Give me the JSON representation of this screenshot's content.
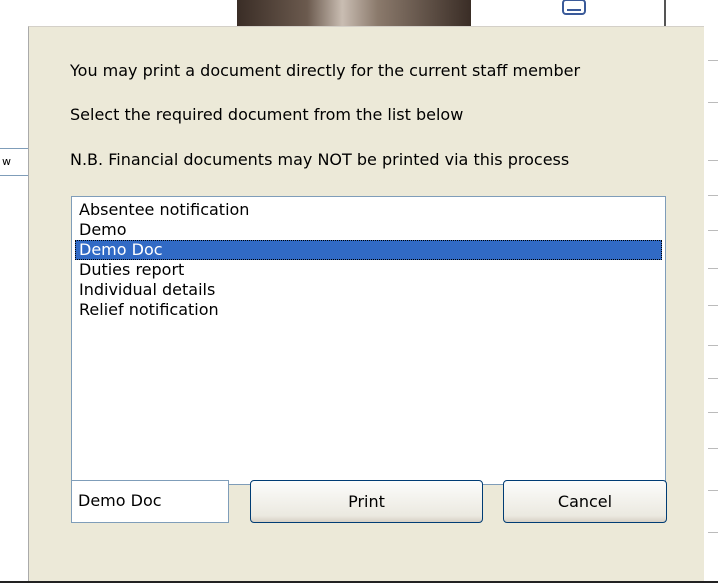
{
  "background": {
    "side_tab_label": "w"
  },
  "dialog": {
    "messages": [
      "You may print a document directly for the current staff member",
      "Select the required document from the list below",
      "N.B. Financial documents may NOT be printed via this process"
    ],
    "documents": [
      "Absentee notification",
      "Demo",
      "Demo Doc",
      "Duties report",
      "Individual details",
      "Relief notification"
    ],
    "selected_document": "Demo Doc",
    "print_label": "Print",
    "cancel_label": "Cancel"
  },
  "colors": {
    "dialog_background": "#ece9d8",
    "selection": "#316ac5",
    "border": "#7f9db9"
  }
}
